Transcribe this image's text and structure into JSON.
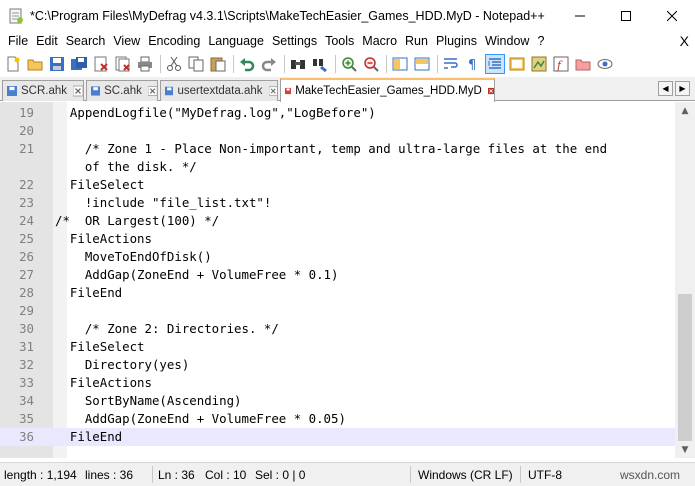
{
  "window": {
    "title": "*C:\\Program Files\\MyDefrag v4.3.1\\Scripts\\MakeTechEasier_Games_HDD.MyD - Notepad++",
    "app_icon": "notepad-plus-plus-icon"
  },
  "menu": {
    "items": [
      "File",
      "Edit",
      "Search",
      "View",
      "Encoding",
      "Language",
      "Settings",
      "Tools",
      "Macro",
      "Run",
      "Plugins",
      "Window",
      "?"
    ],
    "close_glyph": "X"
  },
  "toolbar": {
    "icons": [
      "new-file-icon",
      "open-file-icon",
      "save-icon",
      "save-all-icon",
      "close-icon",
      "close-all-icon",
      "print-icon",
      "cut-icon",
      "copy-icon",
      "paste-icon",
      "undo-icon",
      "redo-icon",
      "find-icon",
      "replace-icon",
      "zoom-in-icon",
      "zoom-out-icon",
      "sync-vertical-icon",
      "sync-horizontal-icon",
      "word-wrap-icon",
      "show-all-chars-icon",
      "indent-guide-icon",
      "user-language-icon",
      "doc-map-icon",
      "function-list-icon",
      "folder-workspace-icon",
      "monitoring-icon"
    ]
  },
  "tabs": [
    {
      "label": "SCR.ahk",
      "active": false
    },
    {
      "label": "SC.ahk",
      "active": false
    },
    {
      "label": "usertextdata.ahk",
      "active": false
    },
    {
      "label": "MakeTechEasier_Games_HDD.MyD",
      "active": true
    }
  ],
  "editor": {
    "lines": [
      {
        "num": "19",
        "text": "  AppendLogfile(\"MyDefrag.log\",\"LogBefore\")"
      },
      {
        "num": "20",
        "text": ""
      },
      {
        "num": "21",
        "text": "    /* Zone 1 - Place Non-important, temp and ultra-large files at the end"
      },
      {
        "num": "",
        "text": "    of the disk. */"
      },
      {
        "num": "22",
        "text": "  FileSelect"
      },
      {
        "num": "23",
        "text": "    !include \"file_list.txt\"!"
      },
      {
        "num": "24",
        "text": "/*  OR Largest(100) */"
      },
      {
        "num": "25",
        "text": "  FileActions"
      },
      {
        "num": "26",
        "text": "    MoveToEndOfDisk()"
      },
      {
        "num": "27",
        "text": "    AddGap(ZoneEnd + VolumeFree * 0.1)"
      },
      {
        "num": "28",
        "text": "  FileEnd"
      },
      {
        "num": "29",
        "text": ""
      },
      {
        "num": "30",
        "text": "    /* Zone 2: Directories. */"
      },
      {
        "num": "31",
        "text": "  FileSelect"
      },
      {
        "num": "32",
        "text": "    Directory(yes)"
      },
      {
        "num": "33",
        "text": "  FileActions"
      },
      {
        "num": "34",
        "text": "    SortByName(Ascending)"
      },
      {
        "num": "35",
        "text": "    AddGap(ZoneEnd + VolumeFree * 0.05)"
      },
      {
        "num": "36",
        "text": "  FileEnd",
        "current": true
      }
    ],
    "scroll_fraction": 0.62
  },
  "status": {
    "length": "length : 1,194",
    "lines": "lines : 36",
    "ln": "Ln : 36",
    "col": "Col : 10",
    "sel": "Sel : 0 | 0",
    "eol": "Windows (CR LF)",
    "encoding": "UTF-8",
    "watermark": "wsxdn.com"
  },
  "colors": {
    "active_tab_accent": "#fac06f",
    "current_line": "#e8e8ff",
    "gutter": "#e4e4e4",
    "line_number": "#808080",
    "tab_disk": "#4a7fd0",
    "close_red": "#c0302a"
  }
}
